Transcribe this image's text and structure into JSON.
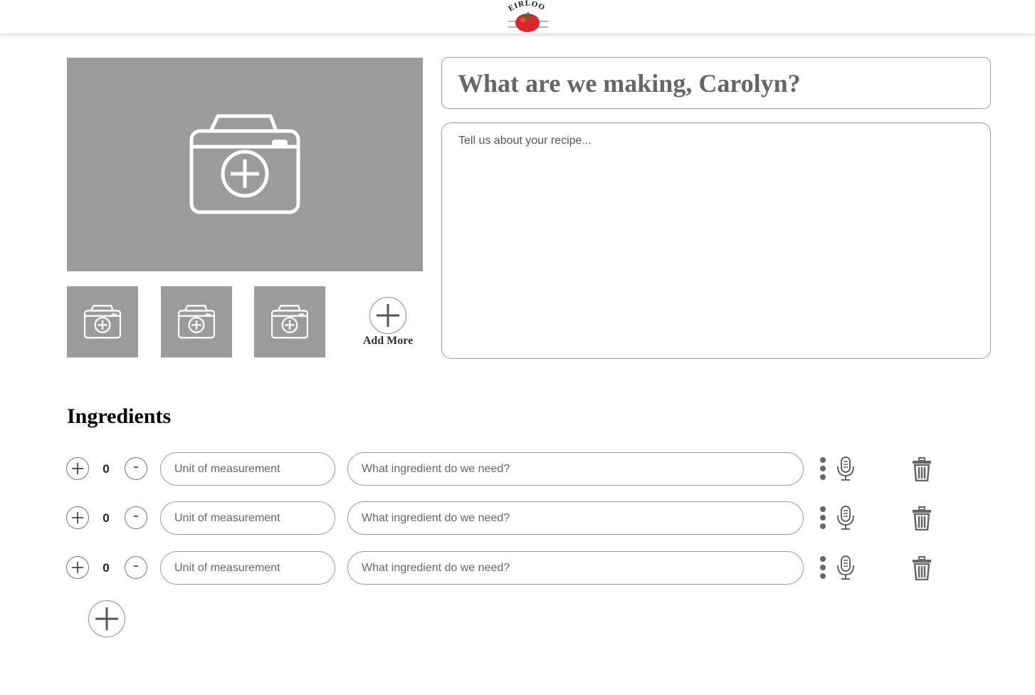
{
  "header": {
    "logo_text": "HEIRLOOM",
    "logo_icon": "tomato-icon"
  },
  "photos": {
    "main_icon": "camera-add-icon",
    "thumb_icon": "camera-add-icon",
    "add_more_label": "Add More",
    "add_more_icon": "plus-icon"
  },
  "recipe": {
    "title_placeholder": "What are we making, Carolyn?",
    "description_placeholder": "Tell us about your recipe..."
  },
  "ingredients": {
    "heading": "Ingredients",
    "increment_label": "+",
    "decrement_label": "-",
    "rows": [
      {
        "quantity": "0",
        "unit_placeholder": "Unit of measurement",
        "ingredient_placeholder": "What ingredient do we need?"
      },
      {
        "quantity": "0",
        "unit_placeholder": "Unit of measurement",
        "ingredient_placeholder": "What ingredient do we need?"
      },
      {
        "quantity": "0",
        "unit_placeholder": "Unit of measurement",
        "ingredient_placeholder": "What ingredient do we need?"
      }
    ],
    "row_icons": [
      "more-vertical-icon",
      "microphone-icon",
      "trash-icon"
    ],
    "add_row_icon": "plus-icon"
  },
  "colors": {
    "photo_placeholder": "#9b9b9b",
    "border": "#9a9a9a",
    "icon_gray": "#666666",
    "tomato_red": "#d8262b"
  }
}
